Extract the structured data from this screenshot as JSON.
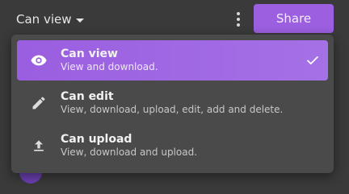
{
  "toolbar": {
    "permission_label": "Can view",
    "share_label": "Share"
  },
  "menu": {
    "items": [
      {
        "title": "Can view",
        "description": "View and download.",
        "icon": "eye-icon",
        "selected": true
      },
      {
        "title": "Can edit",
        "description": "View, download, upload, edit, add and delete.",
        "icon": "pencil-icon",
        "selected": false
      },
      {
        "title": "Can upload",
        "description": "View, download and upload.",
        "icon": "upload-icon",
        "selected": false
      }
    ]
  },
  "colors": {
    "accent": "#9b5fe0",
    "menu_bg": "#4a4a4a",
    "page_bg": "#3a3a3a"
  }
}
